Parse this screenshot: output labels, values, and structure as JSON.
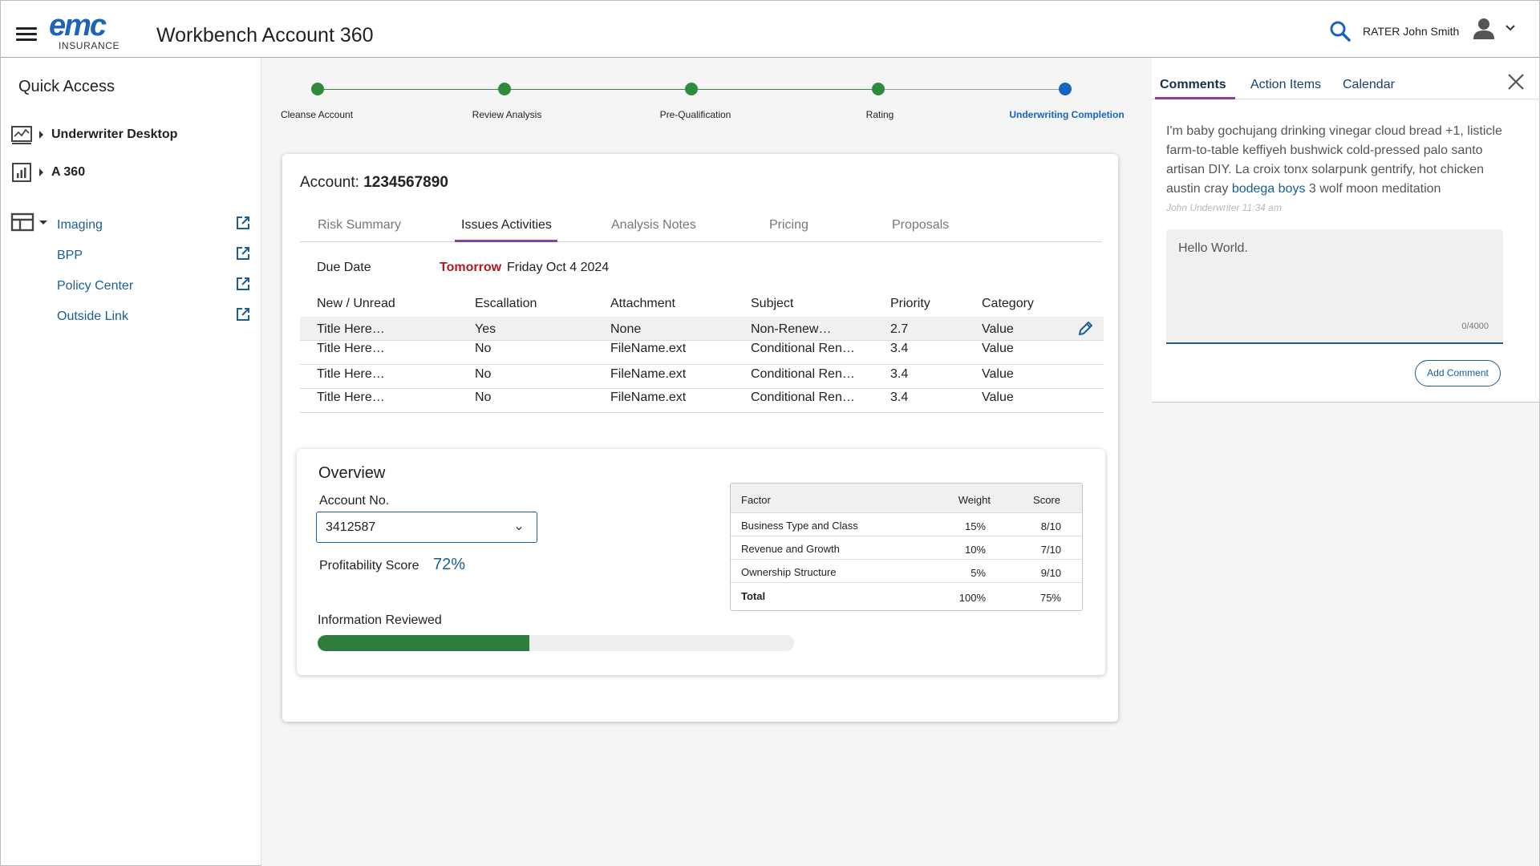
{
  "header": {
    "logo_mark": "emc",
    "logo_sub": "INSURANCE",
    "title": "Workbench Account 360",
    "user_name": "RATER John Smith",
    "icons": {
      "menu": "hamburger-icon",
      "search": "search-icon",
      "user": "user-avatar-icon",
      "dropdown": "chevron-down-icon"
    }
  },
  "sidebar": {
    "title": "Quick Access",
    "items": [
      {
        "label": "Underwriter Desktop",
        "icon": "desktop-chart-icon"
      },
      {
        "label": "A 360",
        "icon": "bar-chart-icon"
      }
    ],
    "group_icon": "dashboard-layout-icon",
    "links": [
      {
        "label": "Imaging",
        "icon": "external-link-icon"
      },
      {
        "label": "BPP",
        "icon": "external-link-icon"
      },
      {
        "label": "Policy Center",
        "icon": "external-link-icon"
      },
      {
        "label": "Outside Link",
        "icon": "external-link-icon"
      }
    ]
  },
  "stepper": {
    "steps": [
      {
        "label": "Cleanse Account",
        "status": "complete"
      },
      {
        "label": "Review Analysis",
        "status": "complete"
      },
      {
        "label": "Pre-Qualification",
        "status": "complete"
      },
      {
        "label": "Rating",
        "status": "complete"
      },
      {
        "label": "Underwriting Completion",
        "status": "current"
      }
    ],
    "colors": {
      "complete": "#2e8b3e",
      "current": "#1565c0"
    }
  },
  "account": {
    "label": "Account:",
    "number": "1234567890",
    "tabs": [
      "Risk Summary",
      "Issues Activities",
      "Analysis Notes",
      "Pricing",
      "Proposals"
    ],
    "active_tab": "Issues Activities",
    "due_label": "Due Date",
    "due_tag": "Tomorrow",
    "due_date": "Friday Oct 4 2024"
  },
  "issues": {
    "columns": [
      "New / Unread",
      "Escallation",
      "Attachment",
      "Subject",
      "Priority",
      "Category"
    ],
    "rows": [
      [
        "Title Here…",
        "Yes",
        "None",
        "Non-Renew…",
        "2.7",
        "Value"
      ],
      [
        "Title Here…",
        "No",
        "FileName.ext",
        "Conditional Ren…",
        "3.4",
        "Value"
      ],
      [
        "Title Here…",
        "No",
        "FileName.ext",
        "Conditional Ren…",
        "3.4",
        "Value"
      ],
      [
        "Title Here…",
        "No",
        "FileName.ext",
        "Conditional Ren…",
        "3.4",
        "Value"
      ]
    ],
    "edit_icon": "pencil-icon"
  },
  "overview": {
    "title": "Overview",
    "account_no_label": "Account No.",
    "account_no_value": "3412587",
    "profitability_label": "Profitability Score",
    "profitability_value": "72%",
    "info_reviewed_label": "Information Reviewed",
    "info_reviewed_progress": 0.445,
    "factors": {
      "columns": [
        "Factor",
        "Weight",
        "Score"
      ],
      "rows": [
        [
          "Business Type and Class",
          "15%",
          "8/10"
        ],
        [
          "Revenue and Growth",
          "10%",
          "7/10"
        ],
        [
          "Ownership Structure",
          "5%",
          "9/10"
        ],
        [
          "Total",
          "100%",
          "75%"
        ]
      ]
    }
  },
  "comments_panel": {
    "tabs": [
      "Comments",
      "Action Items",
      "Calendar"
    ],
    "active_tab": "Comments",
    "comment_text_before": "I'm baby gochujang drinking vinegar cloud bread +1, listicle farm-to-table keffiyeh bushwick cold-pressed palo santo artisan DIY. La croix tonx solarpunk gentrify, hot chicken austin cray ",
    "comment_link": "bodega boys",
    "comment_text_after": " 3 wolf moon meditation",
    "comment_meta": "John Underwriter 11:34 am",
    "input_value": "Hello World.",
    "char_count": "0/4000",
    "add_button": "Add Comment"
  }
}
